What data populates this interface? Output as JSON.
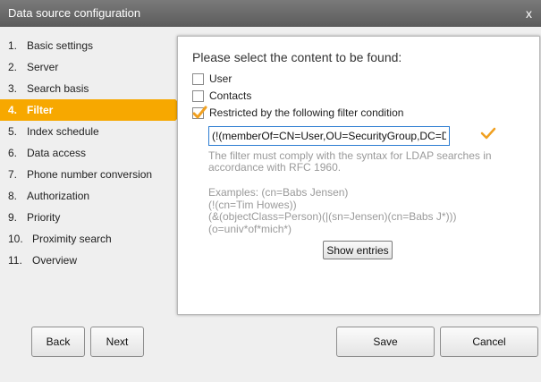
{
  "window": {
    "title": "Data source configuration",
    "close_label": "x"
  },
  "steps": [
    {
      "num": "1.",
      "label": "Basic settings"
    },
    {
      "num": "2.",
      "label": "Server"
    },
    {
      "num": "3.",
      "label": "Search basis"
    },
    {
      "num": "4.",
      "label": "Filter"
    },
    {
      "num": "5.",
      "label": "Index schedule"
    },
    {
      "num": "6.",
      "label": "Data access"
    },
    {
      "num": "7.",
      "label": "Phone number conversion"
    },
    {
      "num": "8.",
      "label": "Authorization"
    },
    {
      "num": "9.",
      "label": "Priority"
    },
    {
      "num": "10.",
      "label": "Proximity search"
    },
    {
      "num": "11.",
      "label": "Overview"
    }
  ],
  "active_step": "4. Filter",
  "panel": {
    "title": "Please select the content to be found:",
    "options": {
      "user": {
        "label": "User",
        "checked": false
      },
      "contacts": {
        "label": "Contacts",
        "checked": false
      },
      "restricted": {
        "label": "Restricted by the following filter condition",
        "checked": true
      }
    },
    "filter_value": "(!(memberOf=CN=User,OU=SecurityGroup,DC=D",
    "hint": "The filter must comply with the syntax for LDAP searches in accordance with RFC 1960.",
    "examples": [
      "Examples: (cn=Babs Jensen)",
      "(!(cn=Tim Howes))",
      "(&(objectClass=Person)(|(sn=Jensen)(cn=Babs J*)))",
      "(o=univ*of*mich*)"
    ],
    "show_entries_label": "Show entries"
  },
  "footer": {
    "back_label": "Back",
    "next_label": "Next",
    "save_label": "Save",
    "cancel_label": "Cancel"
  },
  "colors": {
    "accent": "#f7a800",
    "titlebar": "#666666",
    "input_border": "#2d7dd2"
  },
  "icons": {
    "valid": "checkmark-icon",
    "checkbox_checked": "checkmark-icon"
  }
}
